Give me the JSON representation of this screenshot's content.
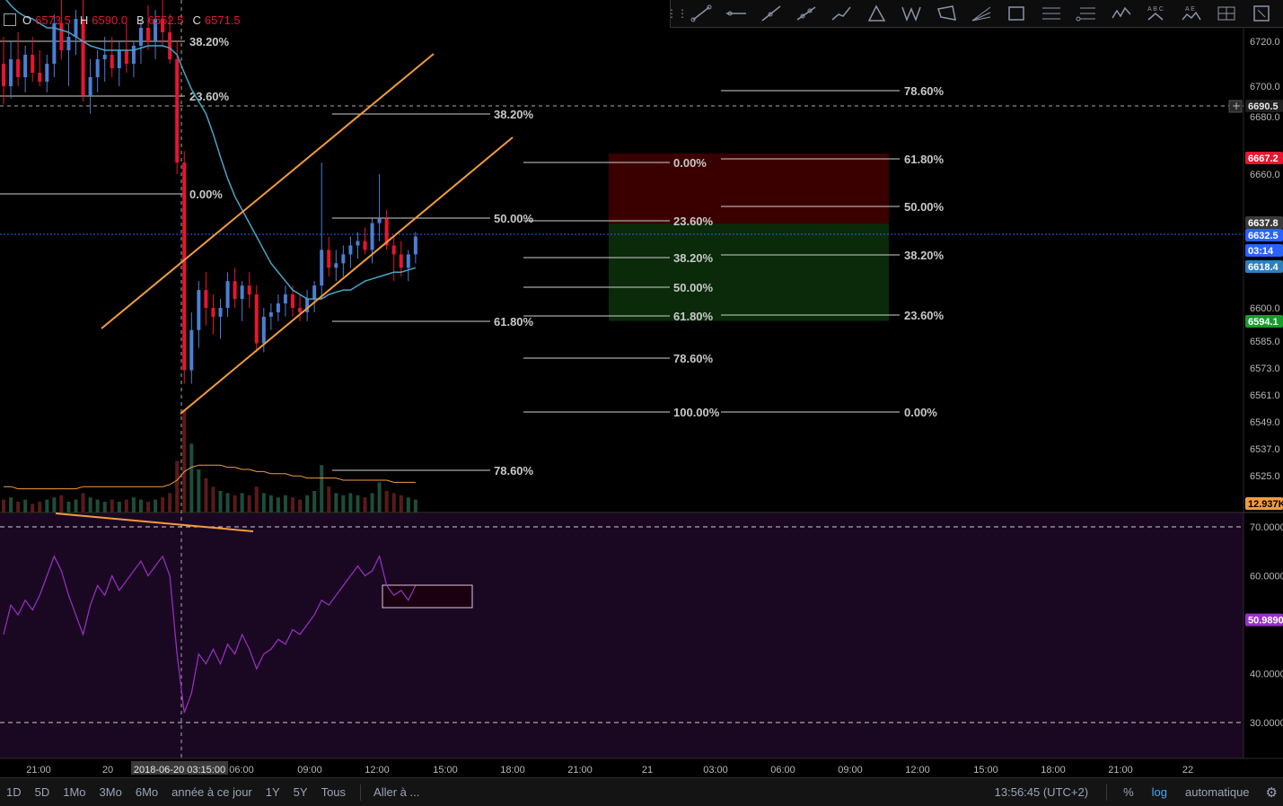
{
  "legend": {
    "o_label": "O",
    "o_value": "6573.5",
    "h_label": "H",
    "h_value": "6590.0",
    "b_label": "B",
    "b_value": "6552.5",
    "c_label": "C",
    "c_value": "6571.5"
  },
  "toolbar": {
    "tools": [
      "trend-line-icon",
      "horizontal-ray-icon",
      "parallel-channel-icon",
      "pitchfork-icon",
      "path-icon",
      "triangle-pattern-icon",
      "xabcd-pattern-icon",
      "abcd-pattern-icon",
      "fib-fan-icon",
      "rectangle-icon",
      "fib-retracement-icon",
      "fib-extension-icon",
      "elliott-wave-icon",
      "abc-pattern-icon",
      "head-shoulders-icon",
      "gann-box-icon",
      "fib-timezone-icon"
    ],
    "labels": {
      "abc": "A B C",
      "ae": "A E"
    }
  },
  "chart_data": {
    "type": "candlestick",
    "price_scale": {
      "tick_labels": [
        "6720.0",
        "6700.0",
        "6680.0",
        "6660.0",
        "6600.0",
        "6585.0",
        "6573.0",
        "6561.0",
        "6549.0",
        "6537.0",
        "6525.0"
      ],
      "log": true
    },
    "price_markers": [
      {
        "value": "6690.5",
        "bg": "#1f1f1f",
        "fg": "#e6e6e6"
      },
      {
        "value": "6667.2",
        "bg": "#e8152f",
        "fg": "#ffffff"
      },
      {
        "value": "6637.8",
        "bg": "#3a3a3a",
        "fg": "#ffffff"
      },
      {
        "value": "6632.5",
        "bg": "#2962ff",
        "fg": "#ffffff"
      },
      {
        "value": "03:14",
        "bg": "#2962ff",
        "fg": "#ffffff"
      },
      {
        "value": "6618.4",
        "bg": "#2f7fbf",
        "fg": "#ffffff"
      },
      {
        "value": "6594.1",
        "bg": "#169c2a",
        "fg": "#ffffff"
      },
      {
        "value": "12.937K",
        "bg": "#f39b3c",
        "fg": "#000000"
      }
    ],
    "candles": [
      {
        "o": 6710,
        "h": 6722,
        "l": 6688,
        "c": 6700
      },
      {
        "o": 6700,
        "h": 6720,
        "l": 6692,
        "c": 6712
      },
      {
        "o": 6712,
        "h": 6724,
        "l": 6700,
        "c": 6704
      },
      {
        "o": 6704,
        "h": 6718,
        "l": 6696,
        "c": 6714
      },
      {
        "o": 6714,
        "h": 6722,
        "l": 6702,
        "c": 6706
      },
      {
        "o": 6706,
        "h": 6716,
        "l": 6700,
        "c": 6702
      },
      {
        "o": 6702,
        "h": 6714,
        "l": 6696,
        "c": 6710
      },
      {
        "o": 6710,
        "h": 6732,
        "l": 6704,
        "c": 6728
      },
      {
        "o": 6728,
        "h": 6740,
        "l": 6712,
        "c": 6716
      },
      {
        "o": 6716,
        "h": 6728,
        "l": 6700,
        "c": 6722
      },
      {
        "o": 6722,
        "h": 6734,
        "l": 6714,
        "c": 6730
      },
      {
        "o": 6730,
        "h": 6740,
        "l": 6690,
        "c": 6694
      },
      {
        "o": 6694,
        "h": 6712,
        "l": 6682,
        "c": 6704
      },
      {
        "o": 6704,
        "h": 6716,
        "l": 6696,
        "c": 6712
      },
      {
        "o": 6712,
        "h": 6722,
        "l": 6702,
        "c": 6714
      },
      {
        "o": 6714,
        "h": 6722,
        "l": 6704,
        "c": 6708
      },
      {
        "o": 6708,
        "h": 6720,
        "l": 6700,
        "c": 6716
      },
      {
        "o": 6716,
        "h": 6728,
        "l": 6706,
        "c": 6710
      },
      {
        "o": 6710,
        "h": 6720,
        "l": 6704,
        "c": 6718
      },
      {
        "o": 6718,
        "h": 6730,
        "l": 6710,
        "c": 6726
      },
      {
        "o": 6726,
        "h": 6736,
        "l": 6716,
        "c": 6720
      },
      {
        "o": 6720,
        "h": 6734,
        "l": 6712,
        "c": 6730
      },
      {
        "o": 6730,
        "h": 6740,
        "l": 6718,
        "c": 6724
      },
      {
        "o": 6724,
        "h": 6732,
        "l": 6710,
        "c": 6712
      },
      {
        "o": 6712,
        "h": 6720,
        "l": 6660,
        "c": 6664
      },
      {
        "o": 6664,
        "h": 6668,
        "l": 6566,
        "c": 6572
      },
      {
        "o": 6572,
        "h": 6598,
        "l": 6566,
        "c": 6590
      },
      {
        "o": 6590,
        "h": 6612,
        "l": 6582,
        "c": 6608
      },
      {
        "o": 6608,
        "h": 6616,
        "l": 6592,
        "c": 6600
      },
      {
        "o": 6600,
        "h": 6606,
        "l": 6588,
        "c": 6596
      },
      {
        "o": 6596,
        "h": 6604,
        "l": 6586,
        "c": 6600
      },
      {
        "o": 6600,
        "h": 6616,
        "l": 6596,
        "c": 6612
      },
      {
        "o": 6612,
        "h": 6618,
        "l": 6600,
        "c": 6604
      },
      {
        "o": 6604,
        "h": 6612,
        "l": 6594,
        "c": 6610
      },
      {
        "o": 6610,
        "h": 6616,
        "l": 6600,
        "c": 6606
      },
      {
        "o": 6606,
        "h": 6610,
        "l": 6580,
        "c": 6584
      },
      {
        "o": 6584,
        "h": 6600,
        "l": 6580,
        "c": 6596
      },
      {
        "o": 6596,
        "h": 6602,
        "l": 6590,
        "c": 6598
      },
      {
        "o": 6598,
        "h": 6606,
        "l": 6594,
        "c": 6602
      },
      {
        "o": 6602,
        "h": 6610,
        "l": 6596,
        "c": 6606
      },
      {
        "o": 6606,
        "h": 6610,
        "l": 6596,
        "c": 6600
      },
      {
        "o": 6600,
        "h": 6606,
        "l": 6594,
        "c": 6598
      },
      {
        "o": 6598,
        "h": 6608,
        "l": 6594,
        "c": 6604
      },
      {
        "o": 6604,
        "h": 6612,
        "l": 6598,
        "c": 6610
      },
      {
        "o": 6610,
        "h": 6664,
        "l": 6604,
        "c": 6626
      },
      {
        "o": 6626,
        "h": 6632,
        "l": 6614,
        "c": 6618
      },
      {
        "o": 6618,
        "h": 6626,
        "l": 6612,
        "c": 6620
      },
      {
        "o": 6620,
        "h": 6628,
        "l": 6614,
        "c": 6624
      },
      {
        "o": 6624,
        "h": 6632,
        "l": 6618,
        "c": 6628
      },
      {
        "o": 6628,
        "h": 6634,
        "l": 6622,
        "c": 6630
      },
      {
        "o": 6630,
        "h": 6636,
        "l": 6624,
        "c": 6626
      },
      {
        "o": 6626,
        "h": 6640,
        "l": 6620,
        "c": 6638
      },
      {
        "o": 6638,
        "h": 6660,
        "l": 6630,
        "c": 6640
      },
      {
        "o": 6640,
        "h": 6644,
        "l": 6626,
        "c": 6628
      },
      {
        "o": 6628,
        "h": 6632,
        "l": 6612,
        "c": 6624
      },
      {
        "o": 6624,
        "h": 6630,
        "l": 6614,
        "c": 6618
      },
      {
        "o": 6618,
        "h": 6626,
        "l": 6612,
        "c": 6624
      },
      {
        "o": 6624,
        "h": 6634,
        "l": 6620,
        "c": 6632
      }
    ],
    "ma_line": [
      6740,
      6736,
      6733,
      6731,
      6730,
      6728,
      6726,
      6726,
      6725,
      6724,
      6722,
      6720,
      6718,
      6717,
      6716,
      6716,
      6716,
      6716,
      6716,
      6717,
      6718,
      6718,
      6718,
      6717,
      6714,
      6706,
      6698,
      6690,
      6682,
      6674,
      6666,
      6658,
      6650,
      6644,
      6638,
      6632,
      6626,
      6620,
      6616,
      6612,
      6608,
      6606,
      6604,
      6604,
      6604,
      6606,
      6607,
      6608,
      6608,
      6610,
      6612,
      6613,
      6614,
      6615,
      6616,
      6616,
      6617,
      6618
    ],
    "volume": [
      6,
      7,
      5,
      6,
      4,
      5,
      6,
      7,
      8,
      5,
      6,
      9,
      7,
      6,
      5,
      6,
      5,
      6,
      7,
      6,
      5,
      6,
      7,
      9,
      24,
      48,
      32,
      20,
      16,
      12,
      10,
      9,
      8,
      9,
      8,
      12,
      9,
      8,
      7,
      8,
      7,
      6,
      8,
      10,
      22,
      12,
      9,
      8,
      9,
      8,
      7,
      9,
      14,
      10,
      9,
      8,
      7,
      6
    ],
    "volume_ma": [
      12,
      12,
      11,
      11,
      11,
      11,
      11,
      11,
      11,
      11,
      11,
      12,
      12,
      12,
      12,
      12,
      12,
      12,
      12,
      12,
      12,
      12,
      12,
      13,
      15,
      19,
      21,
      22,
      22,
      22,
      22,
      21,
      21,
      20,
      20,
      19,
      19,
      18,
      18,
      18,
      17,
      17,
      16,
      16,
      16,
      16,
      16,
      15,
      15,
      15,
      15,
      15,
      15,
      15,
      14,
      14,
      14,
      14
    ],
    "rsi": {
      "values": [
        48,
        54,
        52,
        55,
        53,
        56,
        60,
        64,
        61,
        56,
        52,
        48,
        54,
        58,
        56,
        60,
        57,
        59,
        61,
        63,
        60,
        62,
        64,
        60,
        44,
        32,
        36,
        44,
        42,
        45,
        42,
        46,
        44,
        48,
        45,
        41,
        44,
        45,
        47,
        46,
        49,
        48,
        50,
        52,
        55,
        54,
        56,
        58,
        60,
        62,
        60,
        61,
        64,
        58,
        56,
        57,
        55,
        58
      ],
      "upper": "70.0000",
      "lower": "30.0000",
      "current": "50.9890",
      "tick_labels": [
        "70.0000",
        "60.0000",
        "40.0000",
        "30.0000"
      ]
    },
    "time_axis": [
      "21:00",
      "20",
      "06:00",
      "09:00",
      "12:00",
      "15:00",
      "18:00",
      "21:00",
      "21",
      "03:00",
      "06:00",
      "09:00",
      "12:00",
      "15:00",
      "18:00",
      "21:00",
      "22"
    ],
    "crosshair_time": "2018-06-20 03:15:00",
    "fib_labels": {
      "fib1": [
        "38.20%",
        "23.60%",
        "0.00%"
      ],
      "fib2": [
        "38.20%",
        "50.00%",
        "61.80%",
        "78.60%"
      ],
      "fib3": [
        "0.00%",
        "23.60%",
        "38.20%",
        "50.00%",
        "61.80%",
        "78.60%",
        "100.00%"
      ],
      "fib4": [
        "78.60%",
        "61.80%",
        "50.00%",
        "38.20%",
        "23.60%",
        "0.00%"
      ]
    },
    "colors": {
      "up": "#4a7fd4",
      "down": "#e8152f",
      "ma": "#4aa3c9",
      "channel": "#f39b3c",
      "rsi": "#9b30c8",
      "rsi_bg": "#1a0822",
      "stop_zone": "#3a0000",
      "target_zone": "#0a2a0a"
    }
  },
  "bottom_bar": {
    "ranges": [
      "1D",
      "5D",
      "1Mo",
      "3Mo",
      "6Mo",
      "année à ce jour",
      "1Y",
      "5Y",
      "Tous"
    ],
    "goto": "Aller à ...",
    "clock": "13:56:45 (UTC+2)",
    "percent": "%",
    "log": "log",
    "auto": "automatique"
  }
}
